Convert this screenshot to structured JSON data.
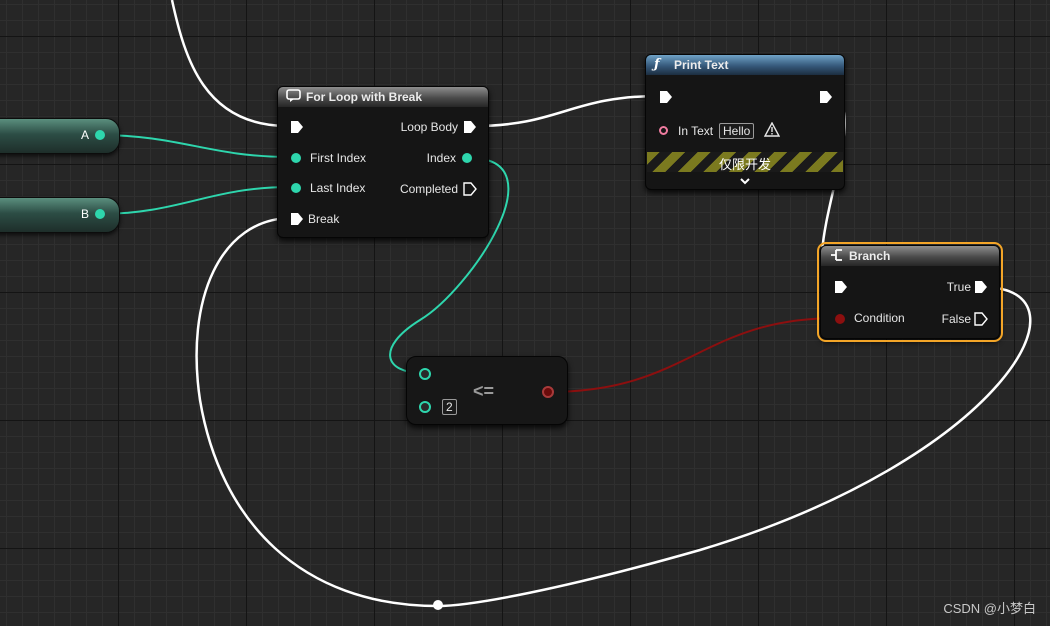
{
  "variables": [
    {
      "name": "A"
    },
    {
      "name": "B"
    }
  ],
  "for_loop": {
    "title": "For Loop with Break",
    "icon": "loop-icon",
    "inputs": {
      "first_index": "First Index",
      "last_index": "Last Index",
      "break": "Break"
    },
    "outputs": {
      "loop_body": "Loop Body",
      "index": "Index",
      "completed": "Completed"
    }
  },
  "print_text": {
    "title": "Print Text",
    "icon": "function-icon",
    "in_text_label": "In Text",
    "in_text_value": "Hello",
    "warning_icon": "warning-icon",
    "dev_only_label": "仅限开发",
    "expand_icon": "chevron-down-icon"
  },
  "branch": {
    "title": "Branch",
    "icon": "branch-icon",
    "condition_label": "Condition",
    "true_label": "True",
    "false_label": "False"
  },
  "compare": {
    "operator": "<=",
    "second_value": "2"
  },
  "colors": {
    "exec_wire": "#ffffff",
    "int_wire": "#2ed6ad",
    "bool_wire": "#8c0f0f",
    "string_pin": "#f07ca0",
    "selection": "#f3a528"
  },
  "watermark": "CSDN @小梦白"
}
